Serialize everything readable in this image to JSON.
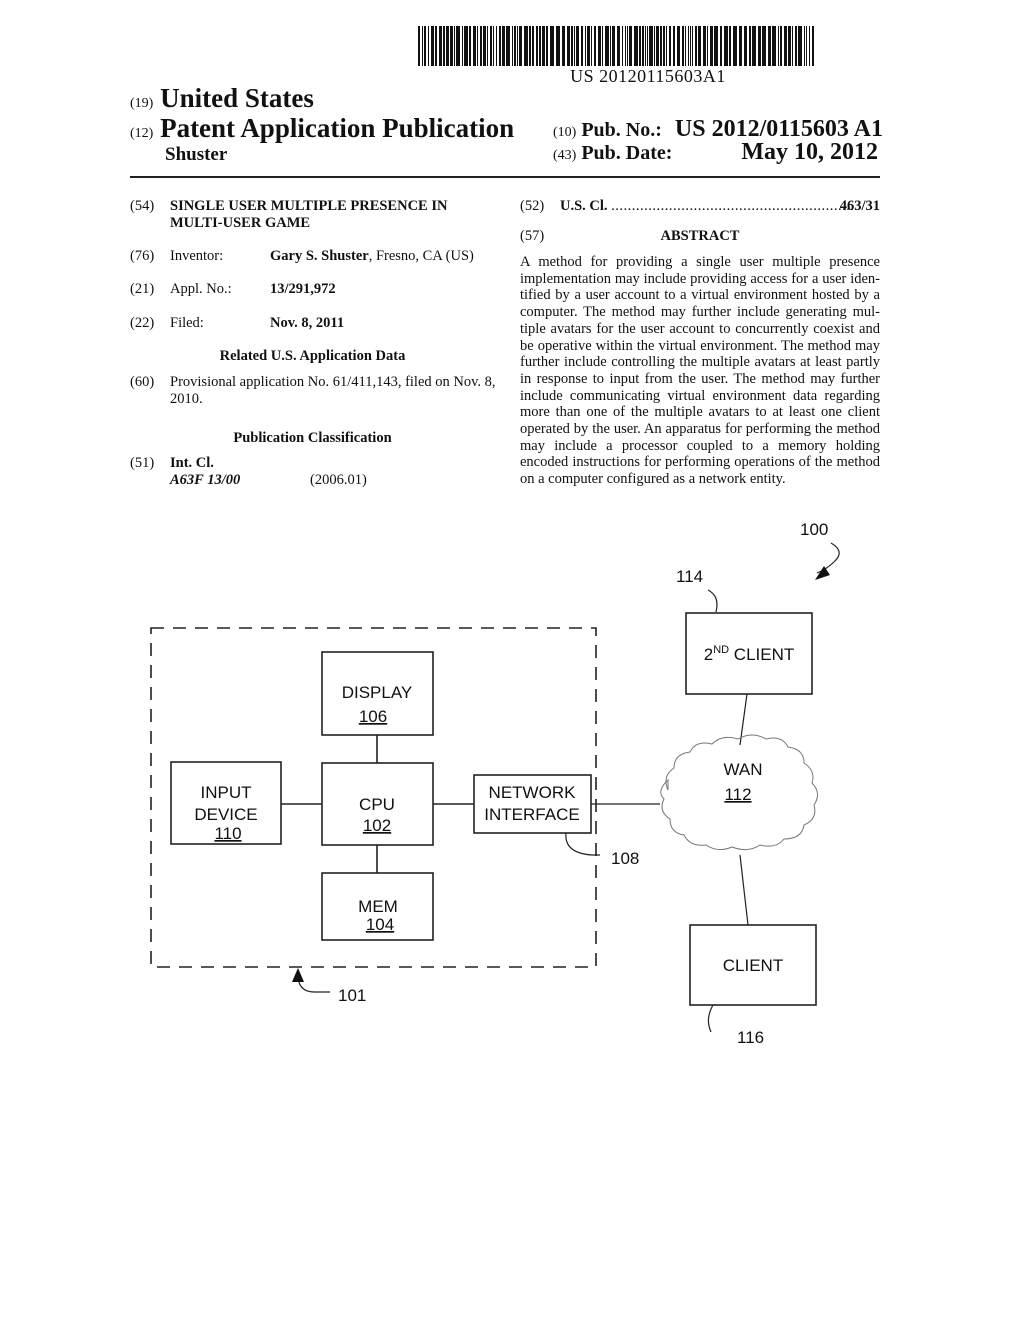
{
  "barcode": {
    "number": "US 20120115603A1"
  },
  "header": {
    "country_code": "(19)",
    "country": "United States",
    "type_code": "(12)",
    "type": "Patent Application Publication",
    "inventor_surname": "Shuster",
    "pub_no_code": "(10)",
    "pub_no_label": "Pub. No.:",
    "pub_no": "US 2012/0115603 A1",
    "pub_date_code": "(43)",
    "pub_date_label": "Pub. Date:",
    "pub_date": "May 10, 2012"
  },
  "left_column": {
    "title": {
      "code": "(54)",
      "text": "SINGLE USER MULTIPLE PRESENCE IN MULTI-USER GAME"
    },
    "inventor": {
      "code": "(76)",
      "label": "Inventor:",
      "name": "Gary S. Shuster",
      "location": ", Fresno, CA (US)"
    },
    "appl_no": {
      "code": "(21)",
      "label": "Appl. No.:",
      "value": "13/291,972"
    },
    "filed": {
      "code": "(22)",
      "label": "Filed:",
      "value": "Nov. 8, 2011"
    },
    "related_heading": "Related U.S. Application Data",
    "provisional": {
      "code": "(60)",
      "text": "Provisional application No. 61/411,143, filed on Nov. 8, 2010."
    },
    "classification_heading": "Publication Classification",
    "int_cl": {
      "code": "(51)",
      "label": "Int. Cl.",
      "class": "A63F 13/00",
      "version": "(2006.01)"
    }
  },
  "right_column": {
    "us_cl": {
      "code": "(52)",
      "label": "U.S. Cl.",
      "dots": "...........................................................",
      "value": "463/31"
    },
    "abstract": {
      "code": "(57)",
      "heading": "ABSTRACT",
      "text": "A method for providing a single user multiple presence implementation may include providing access for a user iden­tified by a user account to a virtual environment hosted by a computer. The method may further include generating mul­tiple avatars for the user account to concurrently coexist and be operative within the virtual environment. The method may further include controlling the multiple avatars at least partly in response to input from the user. The method may further include communicating virtual environment data regarding more than one of the multiple avatars to at least one client operated by the user. An apparatus for performing the method may include a processor coupled to a memory holding encoded instructions for performing operations of the method on a computer configured as a network entity."
    }
  },
  "figure": {
    "system_ref": "100",
    "device_ref": "101",
    "boxes": {
      "display": {
        "label": "DISPLAY",
        "ref": "106"
      },
      "input_device": {
        "label_line1": "INPUT",
        "label_line2": "DEVICE",
        "ref": "110"
      },
      "cpu": {
        "label": "CPU",
        "ref": "102"
      },
      "mem": {
        "label": "MEM",
        "ref": "104"
      },
      "network_interface": {
        "label_line1": "NETWORK",
        "label_line2": "INTERFACE",
        "ref": "108"
      },
      "second_client": {
        "label_num": "2",
        "label_sup": "ND",
        "label_rest": " CLIENT",
        "ref": "114"
      },
      "wan": {
        "label": "WAN",
        "ref": "112"
      },
      "client": {
        "label": "CLIENT",
        "ref": "116"
      }
    }
  }
}
